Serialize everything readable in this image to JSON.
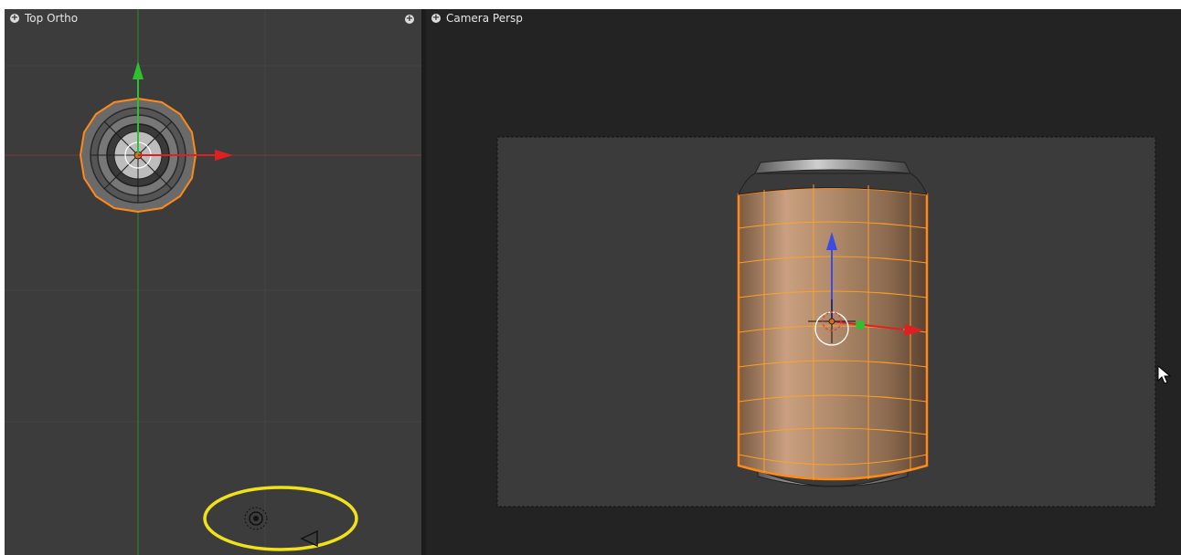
{
  "left_viewport": {
    "title": "Top Ortho",
    "expand_icon": "plus-circle-icon",
    "corner_icon": "plus-circle-icon",
    "background": "#3c3c3c",
    "axis_x_color": "#c83232",
    "axis_y_color": "#2ea52e",
    "highlight_color": "#f0e21a"
  },
  "right_viewport": {
    "title": "Camera Persp",
    "expand_icon": "plus-circle-icon",
    "background": "#232323",
    "camera_frame_background": "#3b3b3b",
    "selection_color": "#ff8a1a",
    "gizmo_colors": {
      "x": "#e02020",
      "y": "#2ec02e",
      "z": "#3a4de0"
    },
    "cursor_icon": "mouse-pointer-icon"
  }
}
